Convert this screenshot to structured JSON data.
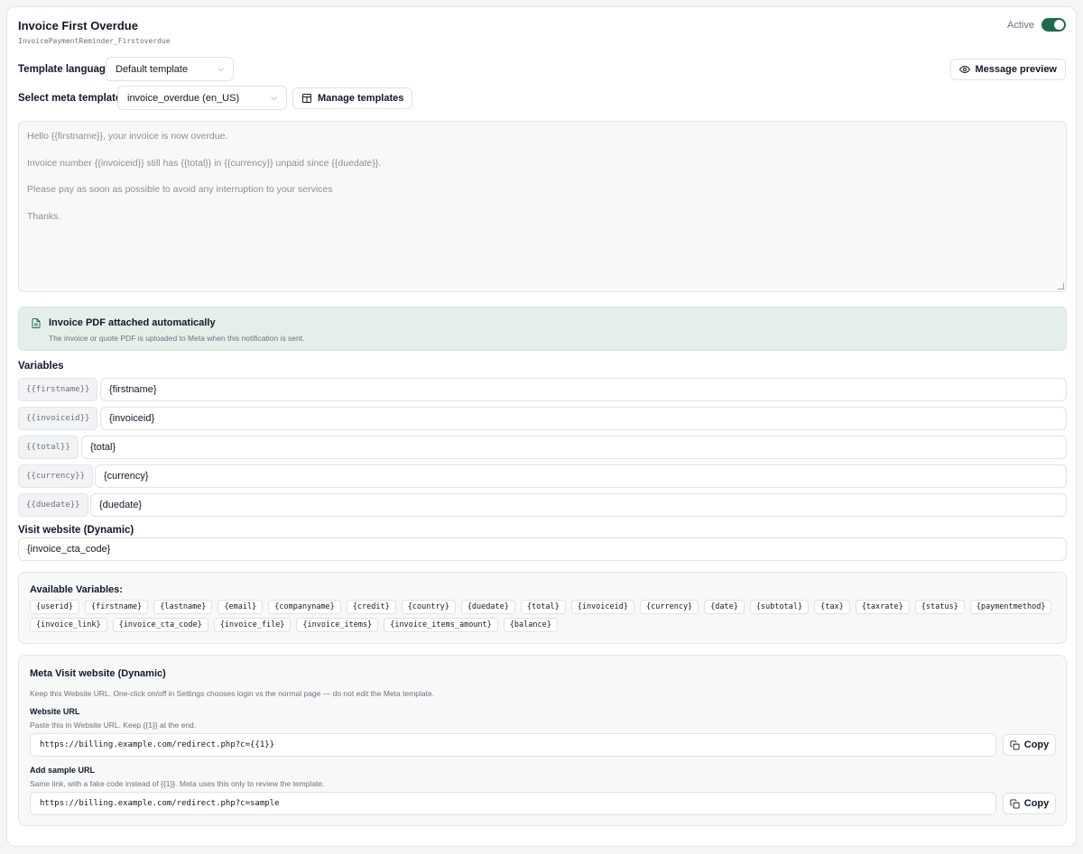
{
  "header": {
    "title": "Invoice First Overdue",
    "subtitle": "InvoicePaymentReminder_Firstoverdue",
    "active_label": "Active",
    "active": true
  },
  "template_language": {
    "label": "Template language",
    "value": "Default template"
  },
  "message_preview_label": "Message preview",
  "meta_template": {
    "label": "Select meta template",
    "value": "invoice_overdue (en_US)",
    "manage_label": "Manage templates"
  },
  "message": {
    "lines": [
      "Hello {{firstname}}, your invoice is now overdue.",
      "Invoice number {{invoiceid}} still has {{total}} in {{currency}} unpaid since {{duedate}}.",
      "Please pay as soon as possible to avoid any interruption to your services",
      "Thanks."
    ]
  },
  "info": {
    "title": "Invoice PDF attached automatically",
    "description": "The invoice or quote PDF is uploaded to Meta when this notification is sent."
  },
  "variables": {
    "label": "Variables",
    "rows": [
      {
        "key": "{{firstname}}",
        "value": "{firstname}"
      },
      {
        "key": "{{invoiceid}}",
        "value": "{invoiceid}"
      },
      {
        "key": "{{total}}",
        "value": "{total}"
      },
      {
        "key": "{{currency}}",
        "value": "{currency}"
      },
      {
        "key": "{{duedate}}",
        "value": "{duedate}"
      }
    ]
  },
  "visit_website": {
    "label": "Visit website (Dynamic)",
    "value": "{invoice_cta_code}"
  },
  "available_variables": {
    "title": "Available Variables:",
    "items": [
      "{userid}",
      "{firstname}",
      "{lastname}",
      "{email}",
      "{companyname}",
      "{credit}",
      "{country}",
      "{duedate}",
      "{total}",
      "{invoiceid}",
      "{currency}",
      "{date}",
      "{subtotal}",
      "{tax}",
      "{taxrate}",
      "{status}",
      "{paymentmethod}",
      "{invoice_link}",
      "{invoice_cta_code}",
      "{invoice_file}",
      "{invoice_items}",
      "{invoice_items_amount}",
      "{balance}"
    ]
  },
  "meta_visit": {
    "title": "Meta Visit website (Dynamic)",
    "description": "Keep this Website URL. One-click on/off in Settings chooses login vs the normal page — do not edit the Meta template.",
    "website_url": {
      "title": "Website URL",
      "hint": "Paste this in Website URL. Keep {{1}} at the end.",
      "value": "https://billing.example.com/redirect.php?c={{1}}",
      "copy_label": "Copy"
    },
    "sample_url": {
      "title": "Add sample URL",
      "hint": "Same link, with a fake code instead of {{1}}. Meta uses this only to review the template.",
      "value": "https://billing.example.com/redirect.php?c=sample",
      "copy_label": "Copy"
    }
  },
  "colors": {
    "toggle_on": "#1f6b48",
    "info_bg": "#e4efea",
    "info_icon": "#1f6b48"
  }
}
